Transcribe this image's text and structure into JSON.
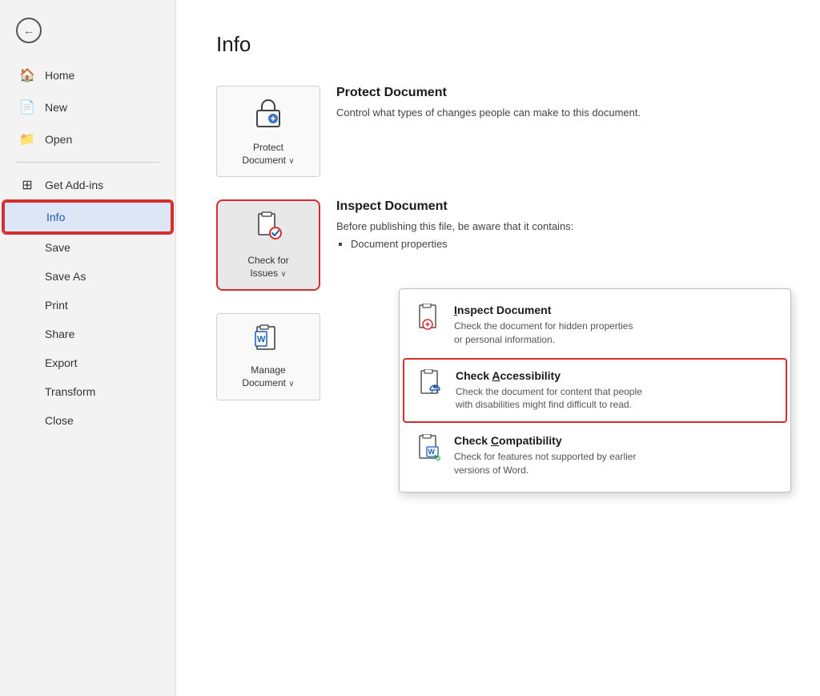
{
  "sidebar": {
    "back_label": "←",
    "items": [
      {
        "id": "home",
        "label": "Home",
        "icon": "🏠"
      },
      {
        "id": "new",
        "label": "New",
        "icon": "📄"
      },
      {
        "id": "open",
        "label": "Open",
        "icon": "📁"
      },
      {
        "id": "get-addins",
        "label": "Get Add-ins",
        "icon": "⊞"
      },
      {
        "id": "info",
        "label": "Info",
        "icon": "",
        "active": true
      },
      {
        "id": "save",
        "label": "Save",
        "icon": ""
      },
      {
        "id": "save-as",
        "label": "Save As",
        "icon": ""
      },
      {
        "id": "print",
        "label": "Print",
        "icon": ""
      },
      {
        "id": "share",
        "label": "Share",
        "icon": ""
      },
      {
        "id": "export",
        "label": "Export",
        "icon": ""
      },
      {
        "id": "transform",
        "label": "Transform",
        "icon": ""
      },
      {
        "id": "close",
        "label": "Close",
        "icon": ""
      }
    ]
  },
  "main": {
    "title": "Info",
    "protect_document": {
      "button_label": "Protect\nDocument",
      "button_arrow": "∨",
      "heading": "Protect Document",
      "description": "Control what types of changes people can make to this document."
    },
    "check_for_issues": {
      "button_label": "Check for\nIssues",
      "button_arrow": "∨",
      "heading": "Inspect Document",
      "description": "Before publishing this file, be aware that it contains:",
      "bullet": "Document properties"
    },
    "manage_document": {
      "button_label": "Manage\nDocument",
      "button_arrow": "∨"
    }
  },
  "dropdown": {
    "items": [
      {
        "id": "inspect-document",
        "heading": "Inspect Document",
        "underline_char": "I",
        "description": "Check the document for hidden properties\nor personal information.",
        "selected": false
      },
      {
        "id": "check-accessibility",
        "heading": "Check Accessibility",
        "underline_char": "A",
        "description": "Check the document for content that people\nwith disabilities might find difficult to read.",
        "selected": true
      },
      {
        "id": "check-compatibility",
        "heading": "Check Compatibility",
        "underline_char": "C",
        "description": "Check for features not supported by earlier\nversions of Word.",
        "selected": false
      }
    ]
  }
}
